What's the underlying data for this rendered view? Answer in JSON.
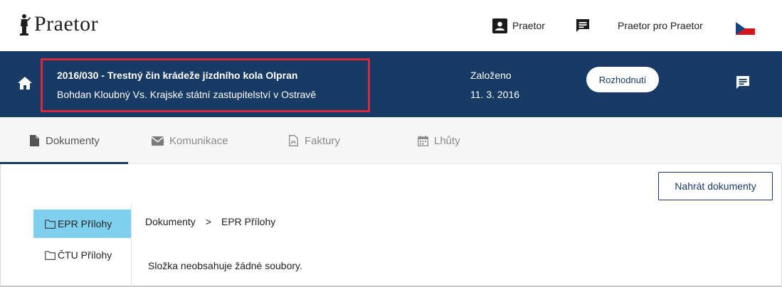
{
  "header": {
    "logo_text": "Praetor",
    "user_label": "Praetor",
    "link_label": "Praetor pro Praetor",
    "icons": [
      "user-card-icon",
      "chat-icon",
      "czech-flag-icon"
    ]
  },
  "case": {
    "title": "2016/030 - Trestný čin krádeže jízdního kola Olpran",
    "subtitle": "Bohdan Kloubný Vs. Krajské státní zastupitelství v Ostravě",
    "founded_label": "Založeno",
    "founded_date": "11. 3. 2016",
    "decision_button": "Rozhodnutí",
    "colors": {
      "background": "#183b66",
      "highlight": "#d9283b"
    }
  },
  "tabs": [
    {
      "label": "Dokumenty",
      "icon": "file-icon",
      "active": true
    },
    {
      "label": "Komunikace",
      "icon": "envelope-icon",
      "active": false
    },
    {
      "label": "Faktury",
      "icon": "pdf-file-icon",
      "active": false
    },
    {
      "label": "Lhůty",
      "icon": "calendar-icon",
      "active": false
    }
  ],
  "content": {
    "upload_button": "Nahrát dokumenty",
    "folders": [
      {
        "label": "EPR Přílohy",
        "icon": "folder-icon",
        "active": true
      },
      {
        "label": "ČTU Přílohy",
        "icon": "folder-icon",
        "active": false
      }
    ],
    "breadcrumb": {
      "root": "Dokumenty",
      "separator": ">",
      "current": "EPR Přílohy"
    },
    "empty_message": "Složka neobsahuje žádné soubory.",
    "active_folder_color": "#7fcfef"
  }
}
